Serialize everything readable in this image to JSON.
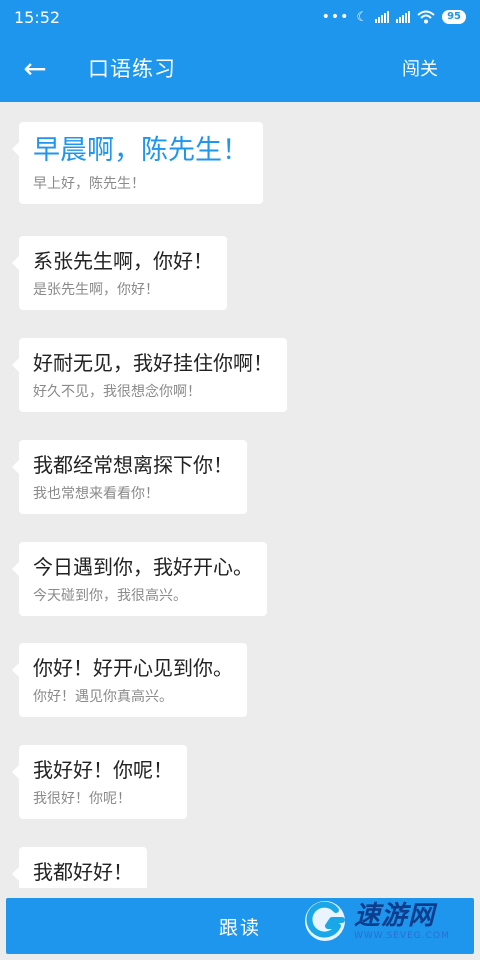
{
  "status_bar": {
    "time": "15:52",
    "dots": "•••",
    "moon": "☾",
    "battery": "95"
  },
  "header": {
    "back_icon": "←",
    "title": "口语练习",
    "action": "闯关"
  },
  "dialogue": [
    {
      "cantonese": "早晨啊，陈先生！",
      "mandarin": "早上好，陈先生！",
      "active": true
    },
    {
      "cantonese": "系张先生啊，你好！",
      "mandarin": "是张先生啊，你好！"
    },
    {
      "cantonese": "好耐无见，我好挂住你啊！",
      "mandarin": "好久不见，我很想念你啊！"
    },
    {
      "cantonese": "我都经常想离探下你！",
      "mandarin": "我也常想来看看你！"
    },
    {
      "cantonese": "今日遇到你，我好开心。",
      "mandarin": "今天碰到你，我很高兴。"
    },
    {
      "cantonese": "你好！好开心见到你。",
      "mandarin": "你好！遇见你真高兴。"
    },
    {
      "cantonese": "我好好！你呢！",
      "mandarin": "我很好！你呢！"
    },
    {
      "cantonese": "我都好好！",
      "mandarin": ""
    }
  ],
  "bottom": {
    "follow_label": "跟读"
  },
  "watermark": {
    "title": "速游网",
    "url": "WWW.SEVEG.COM"
  },
  "colors": {
    "accent": "#1e96ee",
    "background": "#ececec"
  }
}
